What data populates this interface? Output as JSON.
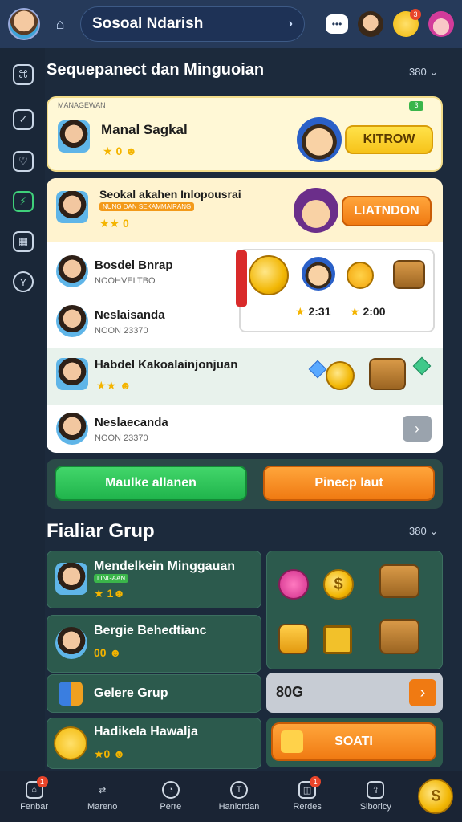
{
  "header": {
    "search_text": "Sosoal Ndarish",
    "chevron": "›"
  },
  "sections": {
    "top_title": "Sequepanect dan Minguoian",
    "top_more": "380",
    "group_title": "Fialiar Grup",
    "group_more": "380"
  },
  "cards": [
    {
      "tag": "MANAGEWAN",
      "title": "Manal Sagkal",
      "stars": "★ 0 ☻",
      "button": "KITROW",
      "badge": "3"
    },
    {
      "title": "Seokal akahen Inlopousrai",
      "tag": "NUNG DAN SEKAMMAIRANG",
      "stars": "★★ 0",
      "button": "LIATNDON"
    }
  ],
  "list_rows": [
    {
      "title": "Bosdel Bnrap",
      "sub": "NOOHVELTBO"
    },
    {
      "title": "Neslaisanda",
      "sub": "NOON 23370"
    },
    {
      "title": "Habdel Kakoalainjonjuan",
      "stars": "★★ ☻"
    },
    {
      "title": "Neslaecanda",
      "sub": "NOON 23370"
    }
  ],
  "reward_box": {
    "left_value": "2:31",
    "right_value": "2:00"
  },
  "main_buttons": {
    "green": "Maulke allanen",
    "orange": "Pinecp laut"
  },
  "groups": [
    {
      "title": "Mendelkein Minggauan",
      "tag": "LINGAAN",
      "stars": "★ 1☻"
    },
    {
      "title": "Bergie Behedtianc",
      "stars": "00 ☻"
    },
    {
      "title": "Gelere Grup"
    },
    {
      "title": "Hadikela Hawalja",
      "stars": "★0 ☻"
    }
  ],
  "grid_panel": {
    "code_label": "80G",
    "button": "SOATI"
  },
  "bottom_nav": [
    {
      "label": "Fenbar",
      "icon": "home-icon",
      "badge": "1"
    },
    {
      "label": "Mareno",
      "icon": "swap-icon"
    },
    {
      "label": "Perre",
      "icon": "clock-icon"
    },
    {
      "label": "Hanlordan",
      "icon": "timer-icon"
    },
    {
      "label": "Rerdes",
      "icon": "box-icon",
      "badge": "1"
    },
    {
      "label": "Siboricy",
      "icon": "share-icon"
    }
  ],
  "colors": {
    "accent_green": "#20b44c",
    "accent_orange": "#f07a12",
    "accent_yellow": "#f6c31a",
    "bg": "#1c2a3c"
  }
}
